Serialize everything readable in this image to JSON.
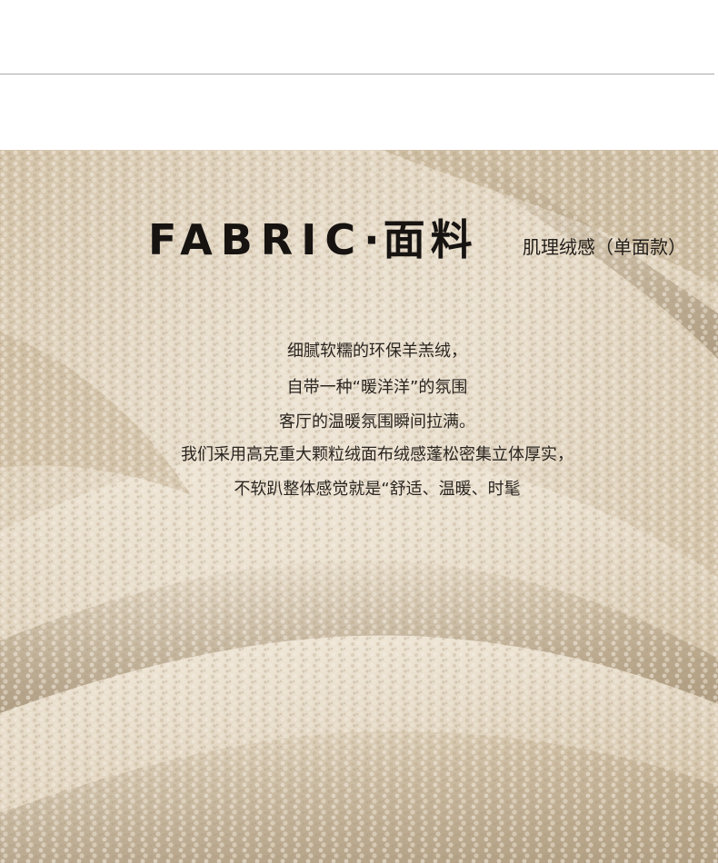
{
  "header": {
    "title_en": "FABRIC",
    "title_sep": "·",
    "title_cn": "面料",
    "subtitle": "肌理绒感（单面款）"
  },
  "description": {
    "lines": [
      "细腻软糯的环保羊羔绒，",
      "自带一种“暖洋洋”的氛围",
      "客厅的温暖氛围瞬间拉满。",
      "我们采用高克重大颗粒绒面布绒感蓬松密集立体厚实，",
      "不软趴整体感觉就是“舒适、温暖、时髦"
    ]
  },
  "colors": {
    "fabric_base": "#d8c9b2",
    "fabric_highlight": "#efe6d7",
    "fabric_shadow": "#a8957a",
    "title_text": "#161311",
    "body_text": "#2a2520",
    "divider": "#a9a9a9"
  },
  "image": {
    "subject": "beige-lambswool-fabric-folds"
  }
}
